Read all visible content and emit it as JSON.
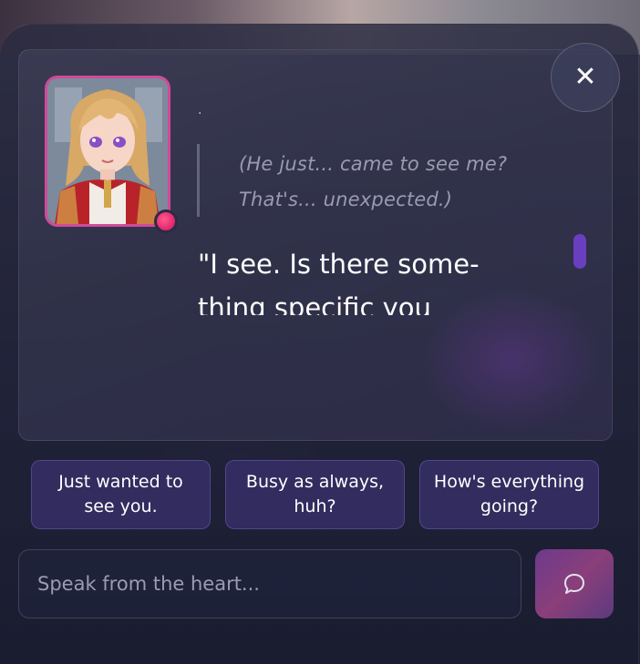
{
  "dialogue": {
    "speaker": ".",
    "thought": "(He just... came to see me?\nThat's... unexpected.)",
    "speech": "\"I see. Is there some-\nthing specific you"
  },
  "close_button": {
    "icon": "close-icon",
    "label": "✕"
  },
  "avatar": {
    "icon": "character-portrait",
    "status_color": "#e0246a"
  },
  "choices": [
    {
      "label": "Just wanted to\nsee you."
    },
    {
      "label": "Busy as always,\nhuh?"
    },
    {
      "label": "How's everything\ngoing?"
    }
  ],
  "input": {
    "placeholder": "Speak from the heart..."
  },
  "send_button": {
    "icon": "chat-bubble-icon"
  },
  "colors": {
    "accent": "#6a3fbf",
    "avatar_border": "#d04a9a",
    "choice_bg": "#3a306e"
  }
}
